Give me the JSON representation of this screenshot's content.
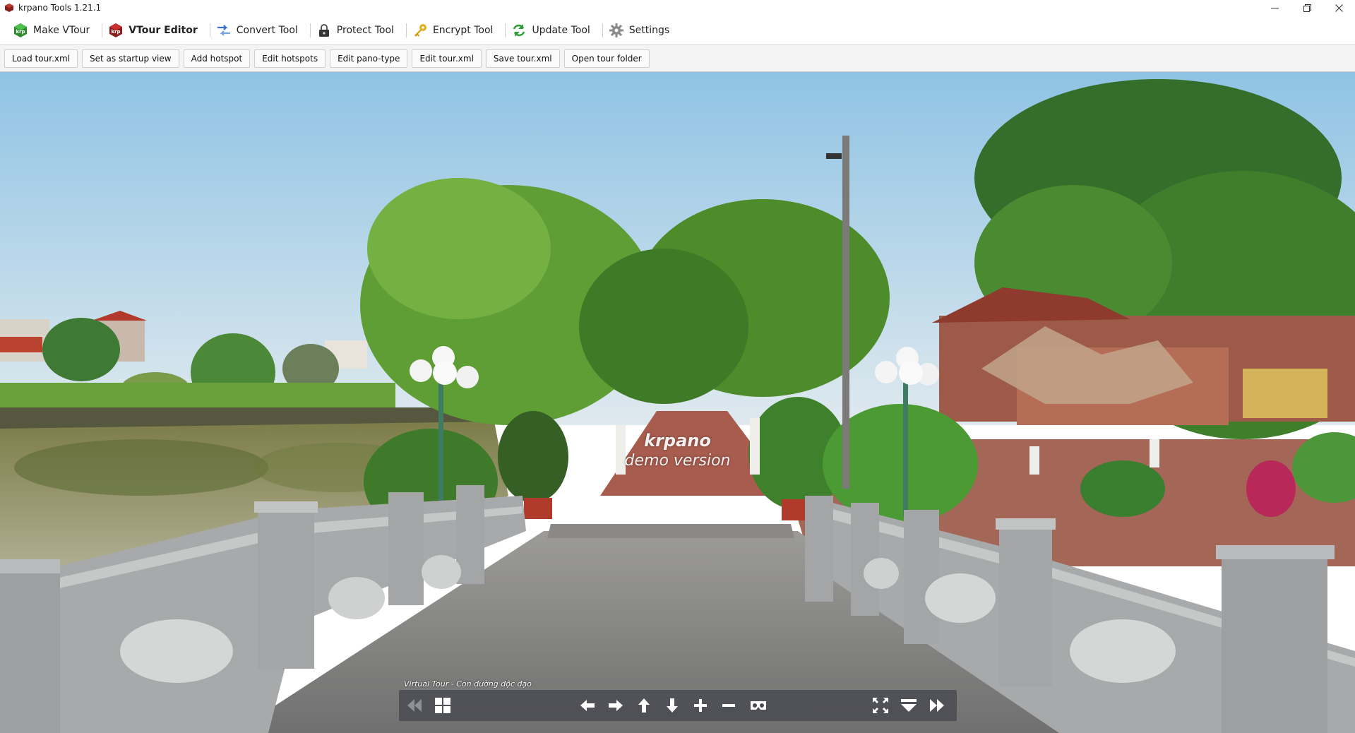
{
  "window": {
    "title": "krpano Tools 1.21.1"
  },
  "main_toolbar": {
    "items": [
      {
        "label": "Make VTour",
        "icon": "krpano-logo-green-icon",
        "active": false
      },
      {
        "label": "VTour Editor",
        "icon": "krpano-logo-red-icon",
        "active": true
      },
      {
        "label": "Convert Tool",
        "icon": "convert-arrows-icon",
        "active": false
      },
      {
        "label": "Protect Tool",
        "icon": "padlock-icon",
        "active": false
      },
      {
        "label": "Encrypt Tool",
        "icon": "key-icon",
        "active": false
      },
      {
        "label": "Update Tool",
        "icon": "refresh-icon",
        "active": false
      },
      {
        "label": "Settings",
        "icon": "gear-icon",
        "active": false
      }
    ]
  },
  "sub_toolbar": {
    "buttons": [
      "Load tour.xml",
      "Set as startup view",
      "Add hotspot",
      "Edit hotspots",
      "Edit pano-type",
      "Edit tour.xml",
      "Save tour.xml",
      "Open tour folder"
    ]
  },
  "viewer": {
    "watermark_line1": "krpano",
    "watermark_line2": "demo version",
    "tour_title": "Virtual Tour - Con đường độc đạo"
  },
  "colors": {
    "sky": "#a9cfe6",
    "foliage": "#4f8f2f",
    "stone": "#a9abac",
    "brick": "#a0584c",
    "controlbar": "#464650"
  }
}
